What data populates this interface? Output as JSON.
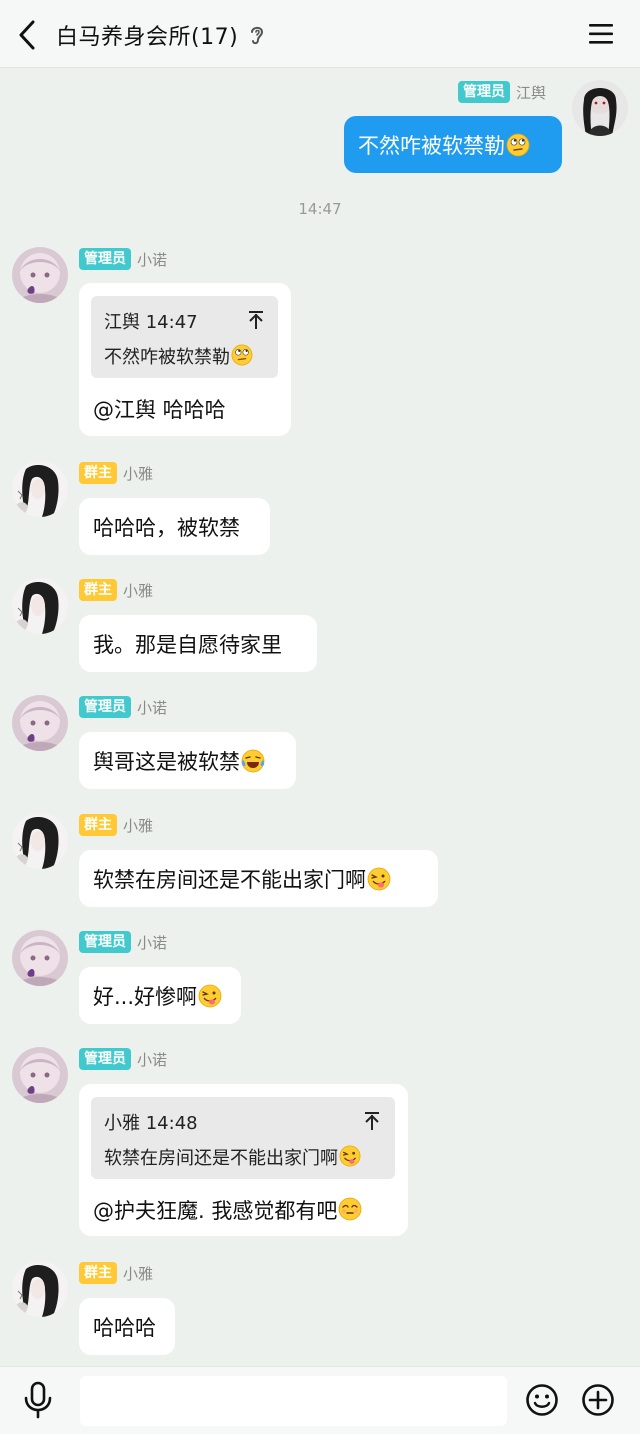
{
  "header": {
    "title": "白马养身会所(17)",
    "back_icon": "chevron-left-icon",
    "ear_icon": "ear-icon",
    "menu_icon": "menu-icon"
  },
  "messages": [
    {
      "type": "outgoing",
      "badge": "管理员",
      "sender": "江舆",
      "text": "不然咋被软禁勒",
      "emoji": "rolling-eyes-emoji"
    },
    {
      "type": "timestamp",
      "text": "14:47"
    },
    {
      "type": "incoming",
      "badge": "管理员",
      "sender": "小诺",
      "quote_head": "江舆 14:47",
      "quote_body": "不然咋被软禁勒",
      "text": "@江舆 哈哈哈"
    },
    {
      "type": "incoming",
      "badge": "群主",
      "sender": "小雅",
      "text": "哈哈哈，被软禁"
    },
    {
      "type": "incoming",
      "badge": "群主",
      "sender": "小雅",
      "text": "我。那是自愿待家里"
    },
    {
      "type": "incoming",
      "badge": "管理员",
      "sender": "小诺",
      "text": "舆哥这是被软禁",
      "emoji": "tears-of-joy-emoji"
    },
    {
      "type": "incoming",
      "badge": "群主",
      "sender": "小雅",
      "text": "软禁在房间还是不能出家门啊",
      "emoji": "zany-face-emoji"
    },
    {
      "type": "incoming",
      "badge": "管理员",
      "sender": "小诺",
      "text": "好...好惨啊",
      "emoji": "zany-face-emoji"
    },
    {
      "type": "incoming",
      "badge": "管理员",
      "sender": "小诺",
      "quote_head": "小雅 14:48",
      "quote_body": "软禁在房间还是不能出家门啊",
      "text": "@护夫狂魔. 我感觉都有吧",
      "emoji": "squinting-face-emoji"
    },
    {
      "type": "incoming",
      "badge": "群主",
      "sender": "小雅",
      "text": "哈哈哈"
    }
  ],
  "input": {
    "placeholder": "",
    "value": ""
  },
  "colors": {
    "admin_badge": "#42c9cd",
    "owner_badge": "#ffc935",
    "my_bubble": "#1f9cf0",
    "background": "#edf1ee"
  }
}
